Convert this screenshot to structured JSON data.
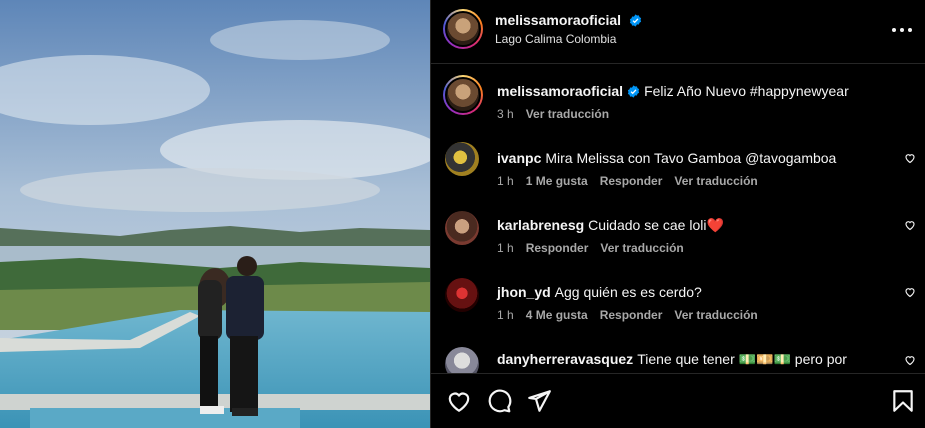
{
  "header": {
    "username": "melissamoraoficial",
    "location": "Lago Calima Colombia"
  },
  "caption": {
    "username": "melissamoraoficial",
    "text": "Feliz Año Nuevo #happynewyear",
    "time": "3 h",
    "translate": "Ver traducción"
  },
  "comments": [
    {
      "username": "ivanpc",
      "text": "Mira Melissa con Tavo Gamboa @tavogamboa",
      "time": "1 h",
      "likes": "1 Me gusta",
      "reply": "Responder",
      "translate": "Ver traducción"
    },
    {
      "username": "karlabrenesg",
      "text": "Cuidado se cae loli❤️",
      "time": "1 h",
      "reply": "Responder",
      "translate": "Ver traducción"
    },
    {
      "username": "jhon_yd",
      "text": "Agg quién es es cerdo?",
      "time": "1 h",
      "likes": "4 Me gusta",
      "reply": "Responder",
      "translate": "Ver traducción"
    },
    {
      "username": "danyherreravasquez",
      "text": "Tiene que tener 💵💴💵 pero por"
    }
  ],
  "icons": [
    "verified-icon",
    "more-options-icon",
    "like-icon",
    "comment-icon",
    "share-icon",
    "save-icon"
  ],
  "colors": {
    "verified": "#0095f6",
    "background": "#000000",
    "secondary_text": "#a8a8a8"
  }
}
